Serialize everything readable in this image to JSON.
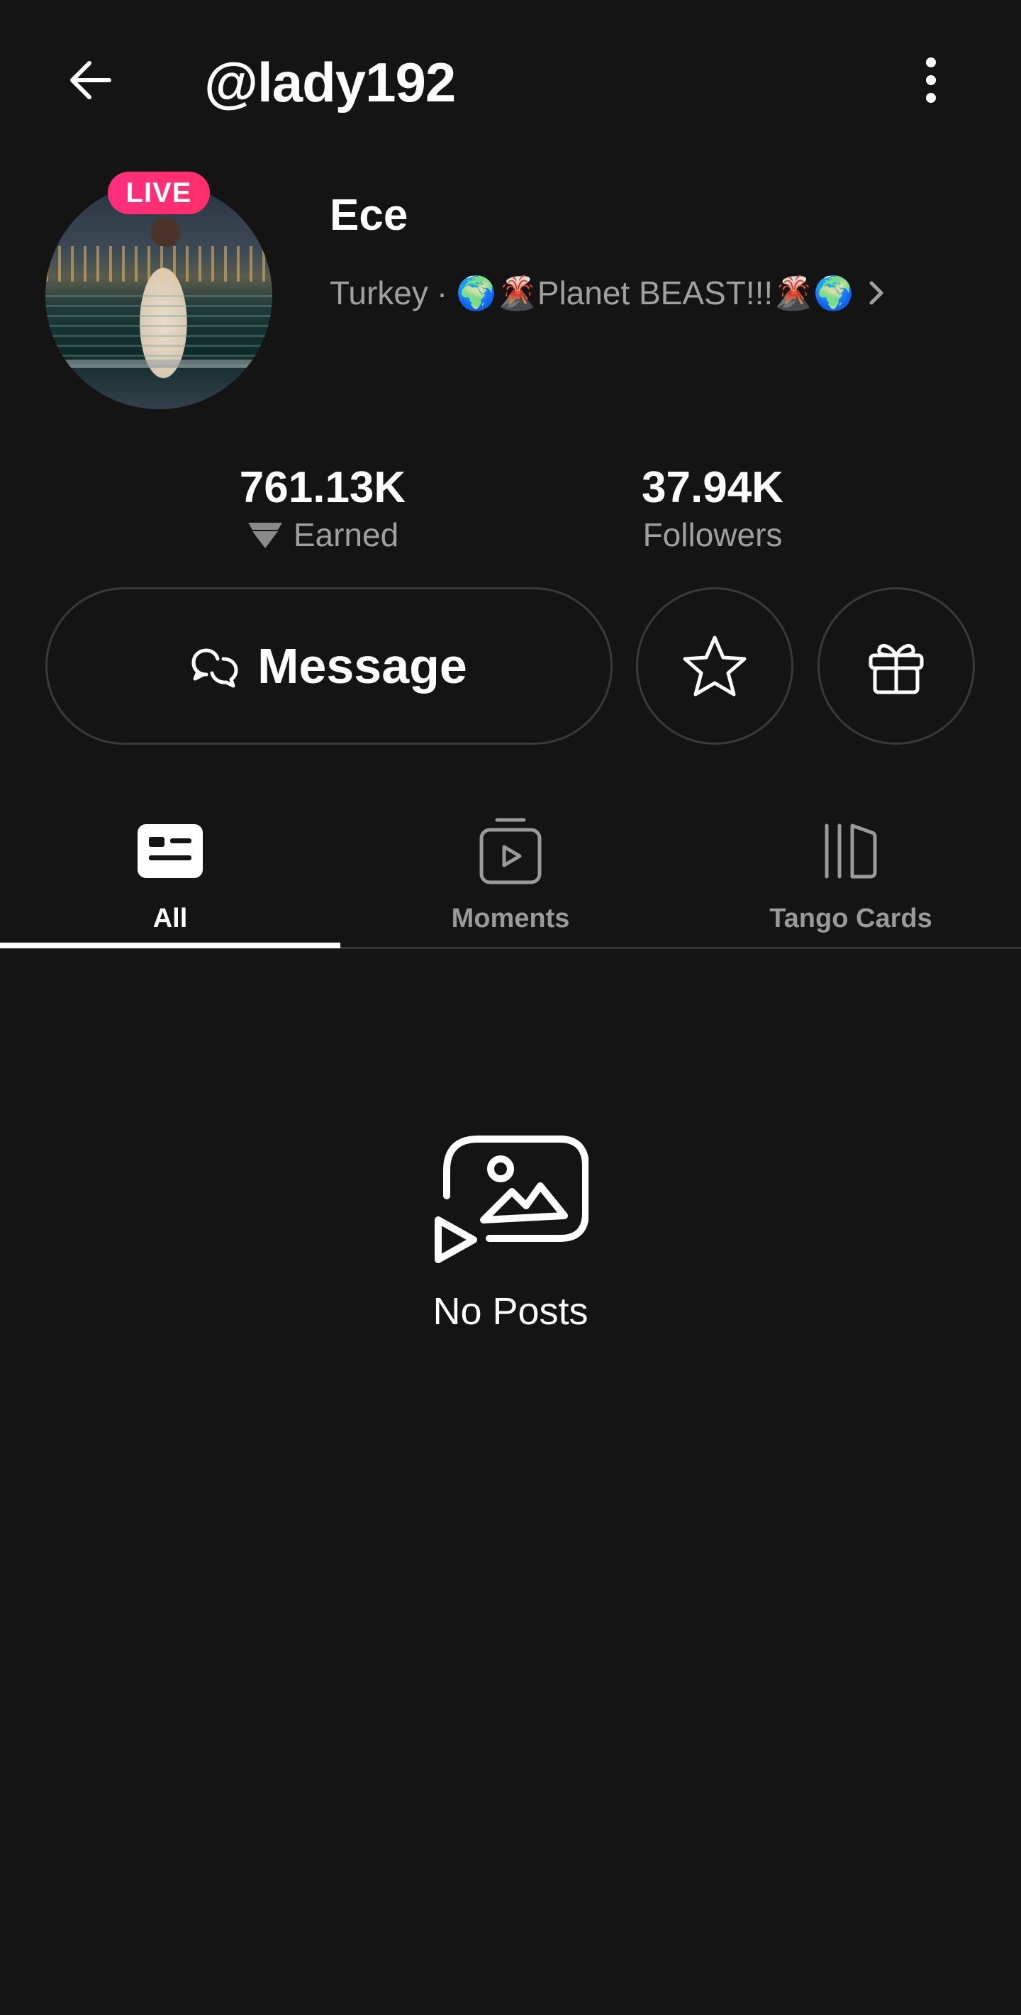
{
  "header": {
    "back_icon": "arrow-left-icon",
    "handle": "@lady192",
    "more_icon": "vertical-dots-icon"
  },
  "profile": {
    "live_badge": "LIVE",
    "name": "Ece",
    "country": "Turkey",
    "separator": "·",
    "tagline": "🌍🌋Planet BEAST!!!🌋🌍",
    "chevron_icon": "chevron-right-icon"
  },
  "stats": {
    "earned_value": "761.13K",
    "earned_label": "Earned",
    "earned_icon": "diamond-icon",
    "followers_value": "37.94K",
    "followers_label": "Followers"
  },
  "actions": {
    "message_label": "Message",
    "message_icon": "chat-bubbles-icon",
    "star_icon": "star-icon",
    "gift_icon": "gift-icon"
  },
  "tabs": [
    {
      "label": "All",
      "icon": "feed-card-icon",
      "active": true
    },
    {
      "label": "Moments",
      "icon": "video-play-icon",
      "active": false
    },
    {
      "label": "Tango Cards",
      "icon": "cards-stack-icon",
      "active": false
    }
  ],
  "empty_state": {
    "icon": "media-gallery-icon",
    "label": "No Posts"
  },
  "colors": {
    "background": "#141414",
    "live_badge": "#ff2e7d",
    "muted_text": "#a0a0a0",
    "border": "#3a3a3a"
  }
}
